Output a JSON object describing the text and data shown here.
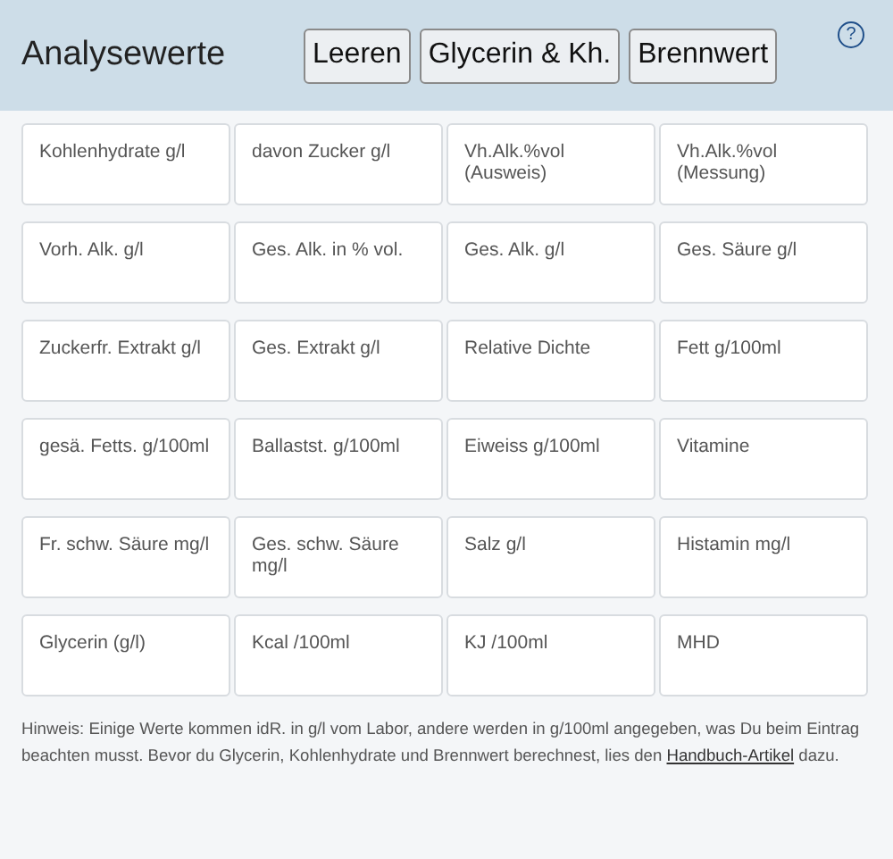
{
  "header": {
    "title": "Analysewerte",
    "buttons": [
      "Leeren",
      "Glycerin & Kh.",
      "Brennwert"
    ],
    "help": "?"
  },
  "fields": [
    {
      "placeholder": "Kohlenhydrate g/l"
    },
    {
      "placeholder": "davon Zucker g/l"
    },
    {
      "placeholder": "Vh.Alk.%vol (Ausweis)"
    },
    {
      "placeholder": "Vh.Alk.%vol (Messung)"
    },
    {
      "placeholder": "Vorh. Alk. g/l"
    },
    {
      "placeholder": "Ges. Alk. in % vol."
    },
    {
      "placeholder": "Ges. Alk. g/l"
    },
    {
      "placeholder": "Ges. Säure g/l"
    },
    {
      "placeholder": "Zuckerfr. Extrakt g/l"
    },
    {
      "placeholder": "Ges. Extrakt g/l"
    },
    {
      "placeholder": "Relative Dichte"
    },
    {
      "placeholder": "Fett g/100ml"
    },
    {
      "placeholder": "gesä. Fetts. g/100ml"
    },
    {
      "placeholder": "Ballastst. g/100ml"
    },
    {
      "placeholder": "Eiweiss g/100ml"
    },
    {
      "placeholder": "Vitamine"
    },
    {
      "placeholder": "Fr. schw. Säure mg/l"
    },
    {
      "placeholder": "Ges. schw. Säure mg/l"
    },
    {
      "placeholder": "Salz g/l"
    },
    {
      "placeholder": "Histamin mg/l"
    },
    {
      "placeholder": "Glycerin (g/l)"
    },
    {
      "placeholder": "Kcal /100ml"
    },
    {
      "placeholder": "KJ /100ml"
    },
    {
      "placeholder": "MHD"
    }
  ],
  "hint": {
    "text": "Hinweis: Einige Werte kommen idR. in g/l vom Labor, andere werden in g/100ml angegeben, was Du beim Eintrag beachten musst. Bevor du Glycerin, Kohlenhydrate und Brennwert berechnest, lies den",
    "link": "Handbuch-Artikel",
    "after": "dazu."
  }
}
